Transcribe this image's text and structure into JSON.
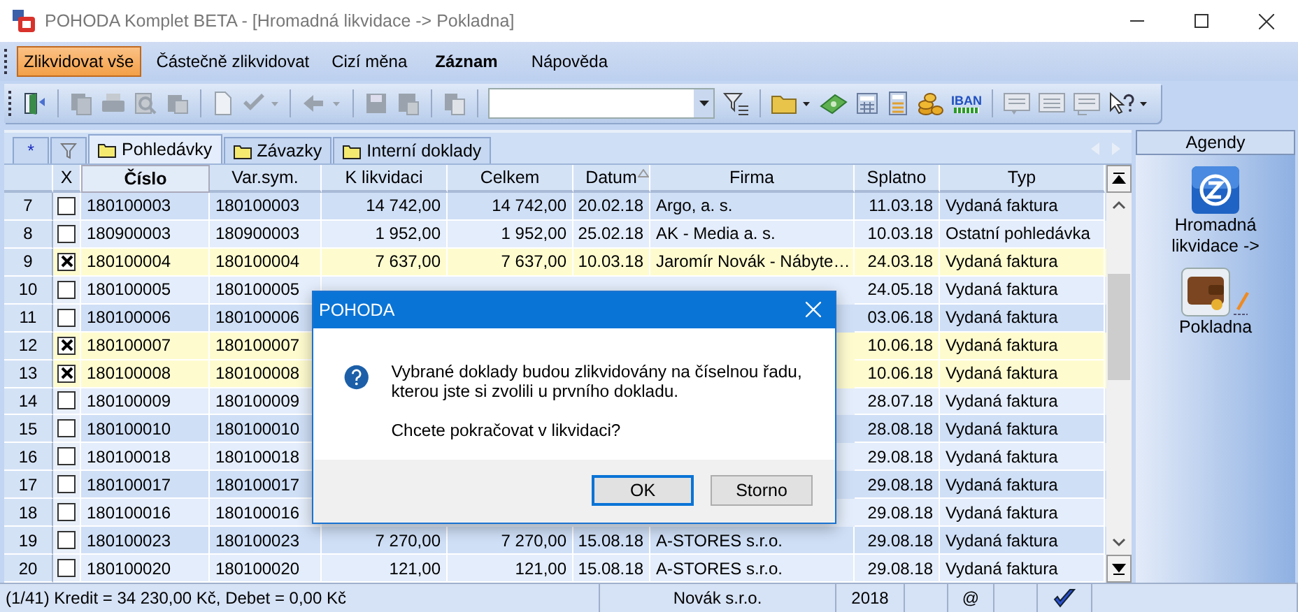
{
  "window": {
    "title": "POHODA Komplet BETA - [Hromadná likvidace -> Pokladna]"
  },
  "menu": [
    {
      "label": "Zlikvidovat vše",
      "selected": true,
      "bold": false
    },
    {
      "label": "Částečně zlikvidovat",
      "selected": false,
      "bold": false
    },
    {
      "label": "Cizí měna",
      "selected": false,
      "bold": false
    },
    {
      "label": "Záznam",
      "selected": false,
      "bold": true
    },
    {
      "label": "Nápověda",
      "selected": false,
      "bold": false
    }
  ],
  "toolbar": {
    "iban_label": "IBAN"
  },
  "tabs": [
    {
      "kind": "symbol",
      "label": "*",
      "selected": false
    },
    {
      "kind": "filter",
      "selected": false
    },
    {
      "kind": "folder",
      "label": "Pohledávky",
      "selected": true
    },
    {
      "kind": "folder",
      "label": "Závazky",
      "selected": false
    },
    {
      "kind": "folder",
      "label": "Interní doklady",
      "selected": false
    }
  ],
  "table": {
    "columns": [
      {
        "label": "X",
        "selected": false,
        "sorted": false
      },
      {
        "label": "Číslo",
        "selected": true,
        "sorted": false
      },
      {
        "label": "Var.sym.",
        "selected": false,
        "sorted": false
      },
      {
        "label": "K likvidaci",
        "selected": false,
        "sorted": false
      },
      {
        "label": "Celkem",
        "selected": false,
        "sorted": false
      },
      {
        "label": "Datum",
        "selected": false,
        "sorted": true
      },
      {
        "label": "Firma",
        "selected": false,
        "sorted": false
      },
      {
        "label": "Splatno",
        "selected": false,
        "sorted": false
      },
      {
        "label": "Typ",
        "selected": false,
        "sorted": false
      }
    ],
    "rows": [
      {
        "number": "7",
        "checked": false,
        "cislo": "180100003",
        "var_sym": "180100003",
        "k_likvidaci": "14 742,00",
        "celkem": "14 742,00",
        "datum": "20.02.18",
        "firma": "Argo, a. s.",
        "splatno": "11.03.18",
        "typ": "Vydaná faktura"
      },
      {
        "number": "8",
        "checked": false,
        "cislo": "180900003",
        "var_sym": "180900003",
        "k_likvidaci": "1 952,00",
        "celkem": "1 952,00",
        "datum": "25.02.18",
        "firma": "AK - Media a. s.",
        "splatno": "10.03.18",
        "typ": "Ostatní pohledávka"
      },
      {
        "number": "9",
        "checked": true,
        "cislo": "180100004",
        "var_sym": "180100004",
        "k_likvidaci": "7 637,00",
        "celkem": "7 637,00",
        "datum": "10.03.18",
        "firma": "Jaromír Novák - Nábyte…",
        "splatno": "24.03.18",
        "typ": "Vydaná faktura"
      },
      {
        "number": "10",
        "checked": false,
        "cislo": "180100005",
        "var_sym": "180100005",
        "splatno": "24.05.18",
        "typ": "Vydaná faktura"
      },
      {
        "number": "11",
        "checked": false,
        "cislo": "180100006",
        "var_sym": "180100006",
        "splatno": "03.06.18",
        "typ": "Vydaná faktura"
      },
      {
        "number": "12",
        "checked": true,
        "cislo": "180100007",
        "var_sym": "180100007",
        "splatno": "10.06.18",
        "typ": "Vydaná faktura"
      },
      {
        "number": "13",
        "checked": true,
        "cislo": "180100008",
        "var_sym": "180100008",
        "splatno": "10.06.18",
        "typ": "Vydaná faktura"
      },
      {
        "number": "14",
        "checked": false,
        "cislo": "180100009",
        "var_sym": "180100009",
        "splatno": "28.07.18",
        "typ": "Vydaná faktura"
      },
      {
        "number": "15",
        "checked": false,
        "cislo": "180100010",
        "var_sym": "180100010",
        "splatno": "28.08.18",
        "typ": "Vydaná faktura"
      },
      {
        "number": "16",
        "checked": false,
        "cislo": "180100018",
        "var_sym": "180100018",
        "splatno": "29.08.18",
        "typ": "Vydaná faktura"
      },
      {
        "number": "17",
        "checked": false,
        "cislo": "180100017",
        "var_sym": "180100017",
        "splatno": "29.08.18",
        "typ": "Vydaná faktura"
      },
      {
        "number": "18",
        "checked": false,
        "cislo": "180100016",
        "var_sym": "180100016",
        "splatno": "29.08.18",
        "typ": "Vydaná faktura"
      },
      {
        "number": "19",
        "checked": false,
        "cislo": "180100023",
        "var_sym": "180100023",
        "k_likvidaci": "7 270,00",
        "celkem": "7 270,00",
        "datum": "15.08.18",
        "firma": "A-STORES s.r.o.",
        "splatno": "29.08.18",
        "typ": "Vydaná faktura"
      },
      {
        "number": "20",
        "checked": false,
        "cislo": "180100020",
        "var_sym": "180100020",
        "k_likvidaci": "121,00",
        "celkem": "121,00",
        "datum": "15.08.18",
        "firma": "A-STORES s.r.o.",
        "splatno": "29.08.18",
        "typ": "Vydaná faktura"
      }
    ]
  },
  "sidebar": {
    "title": "Agendy",
    "items": [
      {
        "kind": "sync",
        "label": "Hromadná likvidace ->"
      },
      {
        "kind": "wallet",
        "label": "Pokladna"
      }
    ]
  },
  "status_bar": {
    "summary": "(1/41) Kredit = 34 230,00 Kč, Debet = 0,00 Kč",
    "company": "Novák s.r.o.",
    "year": "2018",
    "mail": "@"
  },
  "dialog": {
    "title": "POHODA",
    "message": "Vybrané doklady budou zlikvidovány na číselnou řadu, kterou jste si zvolili u prvního dokladu.",
    "question": "Chcete pokračovat v likvidaci?",
    "buttons": [
      {
        "label": "OK",
        "selected": true
      },
      {
        "label": "Storno",
        "selected": false
      }
    ]
  }
}
